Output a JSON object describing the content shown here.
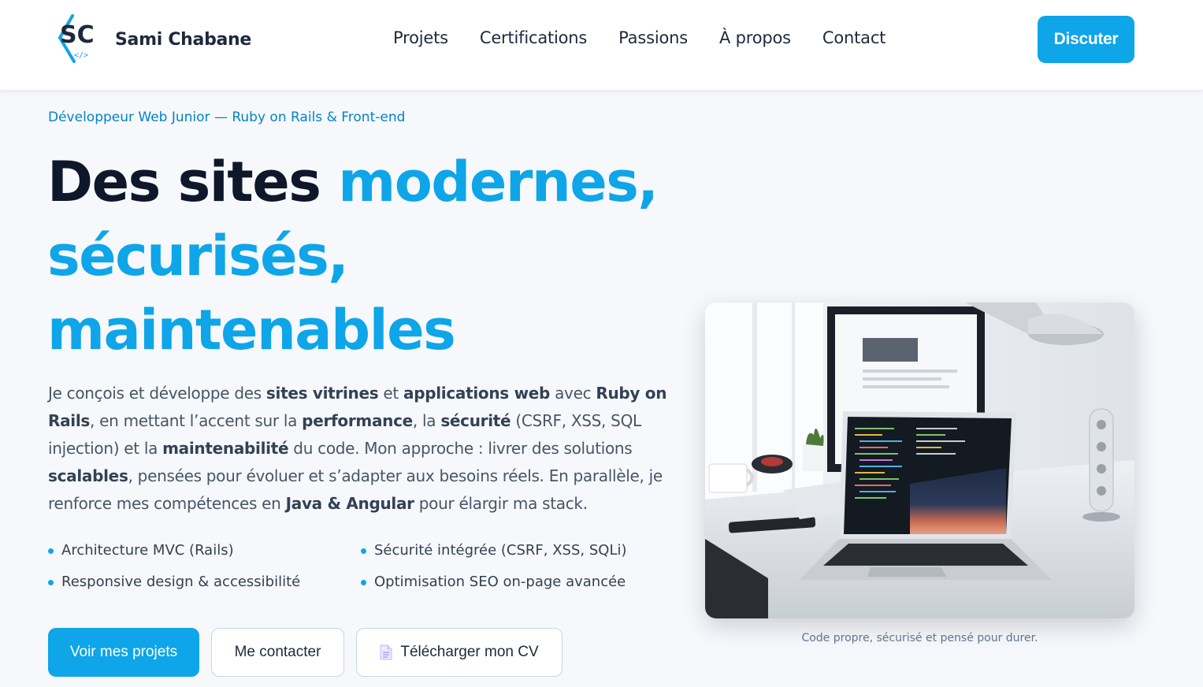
{
  "header": {
    "logo_alt": "SC",
    "brand": "Sami Chabane",
    "nav": [
      {
        "label": "Projets"
      },
      {
        "label": "Certifications"
      },
      {
        "label": "Passions"
      },
      {
        "label": "À propos"
      },
      {
        "label": "Contact"
      }
    ],
    "cta_label": "Discuter"
  },
  "hero": {
    "eyebrow": "Développeur Web Junior — Ruby on Rails & Front-end",
    "headline_plain": "Des sites ",
    "headline_accent_1": "modernes,",
    "headline_accent_2": "sécurisés,",
    "headline_accent_3": "maintenables",
    "intro": {
      "t1": "Je conçois et développe des ",
      "b1": "sites vitrines",
      "t2": " et ",
      "b2": "applications web",
      "t3": " avec ",
      "b3": "Ruby on Rails",
      "t4": ", en mettant l’accent sur la ",
      "b4": "performance",
      "t5": ", la ",
      "b5": "sécurité",
      "t6": " (CSRF, XSS, SQL injection) et la ",
      "b6": "maintenabilité",
      "t7": " du code. Mon approche : livrer des solutions ",
      "b7": "scalables",
      "t8": ", pensées pour évoluer et s’adapter aux besoins réels. En parallèle, je renforce mes compétences en ",
      "b8": "Java & Angular",
      "t9": " pour élargir ma stack."
    },
    "features": [
      "Architecture MVC (Rails)",
      "Sécurité intégrée (CSRF, XSS, SQLi)",
      "Responsive design & accessibilité",
      "Optimisation SEO on-page avancée"
    ],
    "buttons": {
      "projects": "Voir mes projets",
      "contact": "Me contacter",
      "cv": "Télécharger mon CV"
    },
    "caption": "Code propre, sécurisé et pensé pour durer."
  },
  "colors": {
    "accent": "#0ea5e9",
    "heading": "#0f172a",
    "body_text": "#475569"
  },
  "icons": [
    "sc-logo-icon",
    "document-icon",
    "bullet-dot-icon"
  ]
}
